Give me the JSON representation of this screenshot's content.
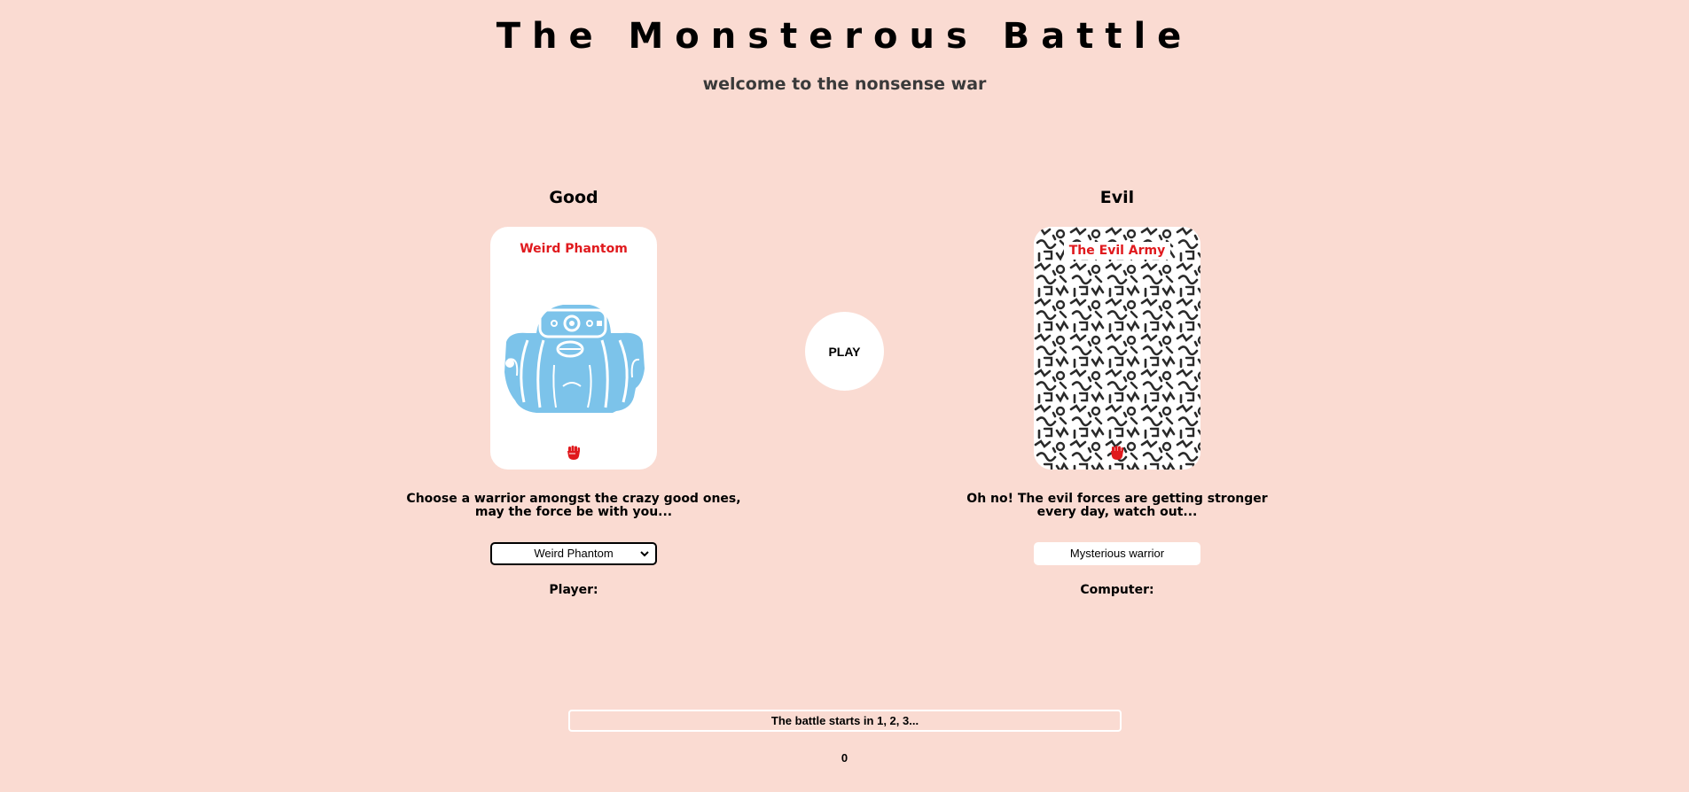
{
  "header": {
    "title": "The Monsterous Battle",
    "subtitle": "welcome to the nonsense war"
  },
  "good": {
    "heading": "Good",
    "card_name": "Weird Phantom",
    "description": "Choose a warrior amongst the crazy good ones, may the force be with you...",
    "selected_warrior": "Weird Phantom",
    "player_label": "Player:"
  },
  "evil": {
    "heading": "Evil",
    "card_name": "The Evil Army",
    "description": "Oh no! The evil forces are getting stronger every day, watch out...",
    "warrior": "Mysterious warrior",
    "computer_label": "Computer:"
  },
  "play_button": "PLAY",
  "status": "The battle starts in 1, 2, 3...",
  "score": "0",
  "colors": {
    "background": "#fadbd2",
    "card_name": "#e0191d",
    "monster": "#7cc3ea",
    "fist": "#e0191d"
  },
  "icons": {
    "fist": "raised-fist-icon",
    "dropdown": "chevron-down-icon"
  }
}
